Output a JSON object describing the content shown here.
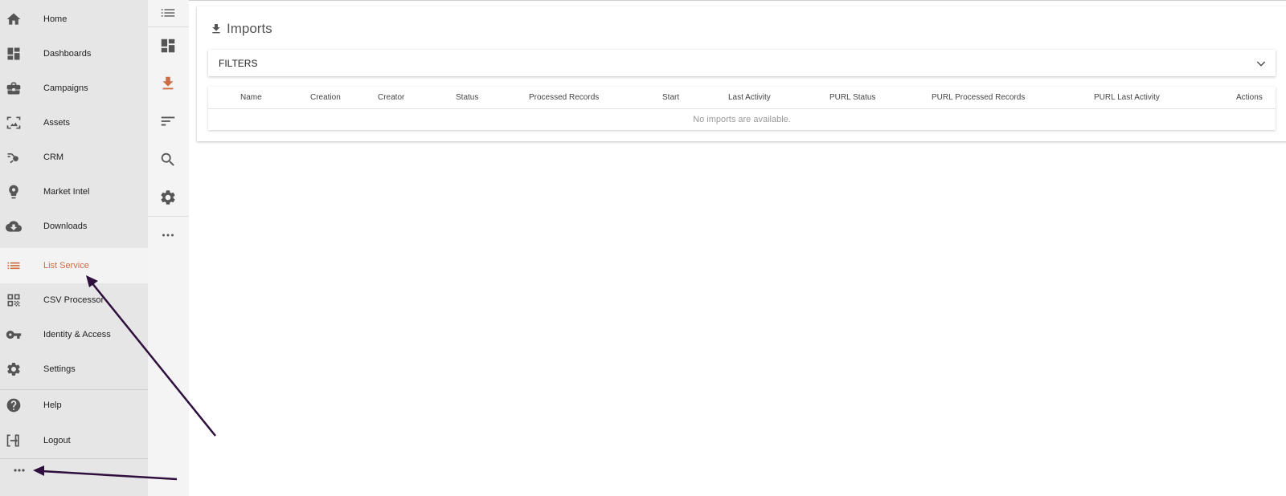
{
  "nav": {
    "items": [
      {
        "label": "Home",
        "icon": "home-icon"
      },
      {
        "label": "Dashboards",
        "icon": "dashboard-icon"
      },
      {
        "label": "Campaigns",
        "icon": "briefcase-icon"
      },
      {
        "label": "Assets",
        "icon": "assets-icon"
      },
      {
        "label": "CRM",
        "icon": "crm-icon"
      },
      {
        "label": "Market Intel",
        "icon": "market-intel-icon"
      },
      {
        "label": "Downloads",
        "icon": "cloud-download-icon"
      },
      {
        "label": "List Service",
        "icon": "list-icon",
        "active": true
      },
      {
        "label": "CSV Processor",
        "icon": "qr-code-icon"
      },
      {
        "label": "Identity & Access",
        "icon": "key-icon"
      },
      {
        "label": "Settings",
        "icon": "gear-icon"
      },
      {
        "label": "Help",
        "icon": "help-icon"
      },
      {
        "label": "Logout",
        "icon": "logout-icon"
      }
    ],
    "more_icon": "more-horizontal-icon"
  },
  "rail": {
    "icons": [
      "menu-icon",
      "dashboard-icon",
      "download-icon",
      "sort-icon",
      "search-icon",
      "gear-icon",
      "more-horizontal-icon"
    ]
  },
  "page": {
    "title": "Imports",
    "title_icon": "download-icon"
  },
  "filters": {
    "label": "FILTERS",
    "icon": "chevron-down-icon"
  },
  "table": {
    "columns": [
      "Name",
      "Creation",
      "Creator",
      "Status",
      "Processed Records",
      "Start",
      "Last Activity",
      "PURL Status",
      "PURL Processed Records",
      "PURL Last Activity",
      "Actions"
    ],
    "empty_message": "No imports are available."
  },
  "colors": {
    "accent": "#cc6d45",
    "nav_bg": "#e6e6e6",
    "rail_bg": "#f4f4f4",
    "icon": "#555555",
    "annotation_arrow": "#2e0f3d"
  }
}
